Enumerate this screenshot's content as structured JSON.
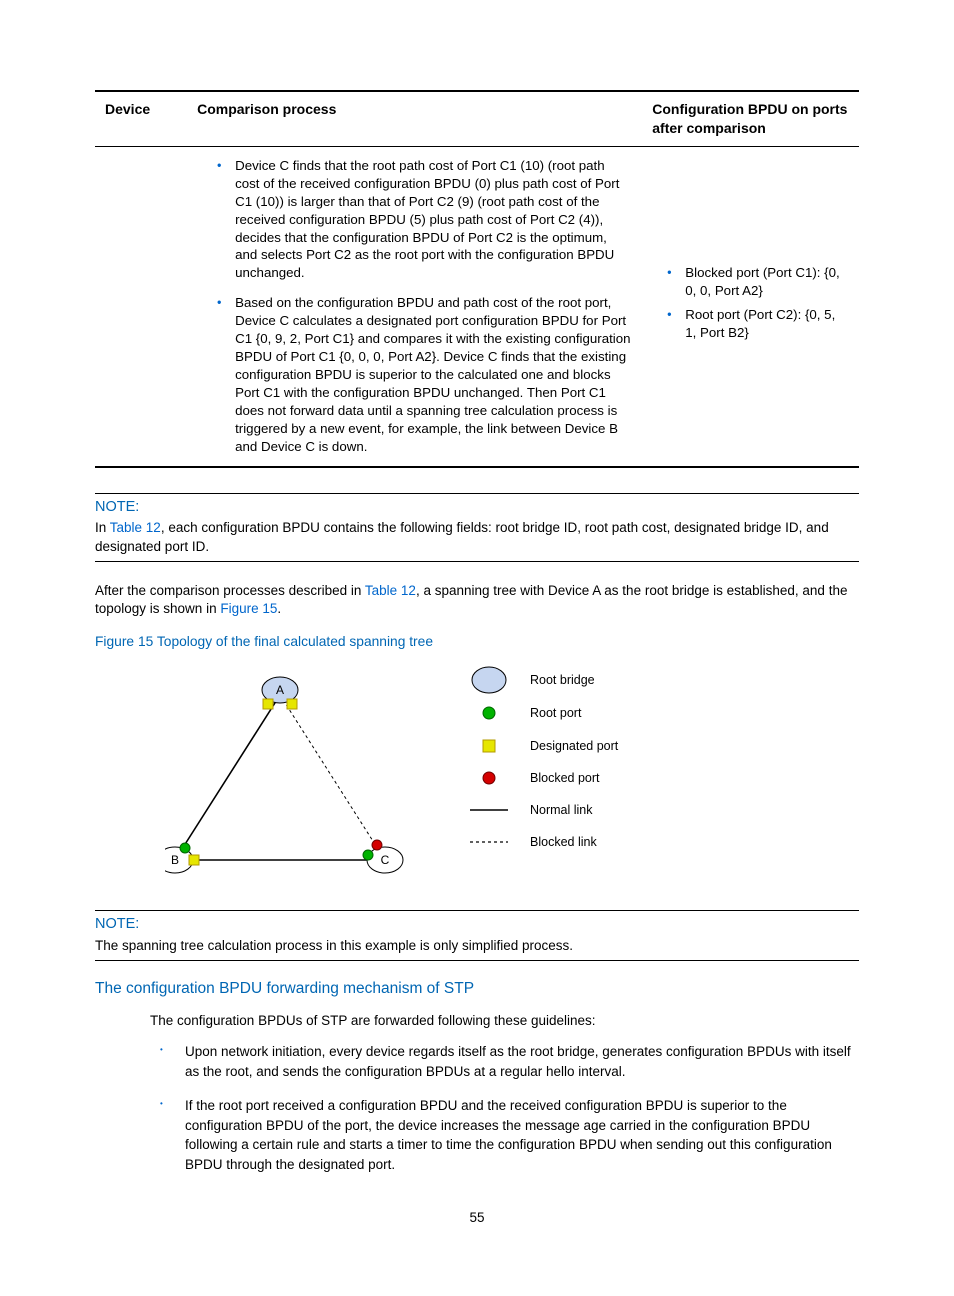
{
  "table": {
    "headers": {
      "device": "Device",
      "comparison": "Comparison process",
      "config": "Configuration BPDU on ports after comparison"
    },
    "row": {
      "comp_bullets": [
        "Device C finds that the root path cost of Port C1 (10) (root path cost of the received configuration BPDU (0) plus path cost of Port C1 (10)) is larger than that of Port C2 (9) (root path cost of the received configuration BPDU (5) plus path cost of Port C2 (4)), decides that the configuration BPDU of Port C2 is the optimum, and selects Port C2 as the root port with the configuration BPDU unchanged.",
        "Based on the configuration BPDU and path cost of the root port, Device C calculates a designated port configuration BPDU for Port C1 {0, 9, 2, Port C1} and compares it with the existing configuration BPDU of Port C1 {0, 0, 0, Port A2}. Device C finds that the existing configuration BPDU is superior to the calculated one and blocks Port C1 with the configuration BPDU unchanged. Then Port C1 does not forward data until a spanning tree calculation process is triggered by a new event, for example, the link between Device B and Device C is down."
      ],
      "config_bullets": [
        "Blocked port (Port C1): {0, 0, 0, Port A2}",
        "Root port (Port C2): {0, 5, 1, Port B2}"
      ]
    }
  },
  "note1": {
    "title": "NOTE:",
    "pre": "In ",
    "link": "Table 12",
    "post": ", each configuration BPDU contains the following fields: root bridge ID, root path cost, designated bridge ID, and designated port ID."
  },
  "para1": {
    "pre": "After the comparison processes described in ",
    "link1": "Table 12",
    "mid": ", a spanning tree with Device A as the root bridge is established, and the topology is shown in ",
    "link2": "Figure 15",
    "end": "."
  },
  "figure": {
    "caption": "Figure 15 Topology of the final calculated spanning tree",
    "nodes": {
      "a": "A",
      "b": "B",
      "c": "C"
    },
    "legend": {
      "root_bridge": "Root bridge",
      "root_port": "Root port",
      "designated_port": "Designated port",
      "blocked_port": "Blocked port",
      "normal_link": "Normal link",
      "blocked_link": "Blocked link"
    }
  },
  "note2": {
    "title": "NOTE:",
    "text": "The spanning tree calculation process in this example is only simplified process."
  },
  "section": {
    "heading": "The configuration BPDU forwarding mechanism of STP",
    "intro": "The configuration BPDUs of STP are forwarded following these guidelines:",
    "bullets": [
      "Upon network initiation, every device regards itself as the root bridge, generates configuration BPDUs with itself as the root, and sends the configuration BPDUs at a regular hello interval.",
      "If the root port received a configuration BPDU and the received configuration BPDU is superior to the configuration BPDU of the port, the device increases the message age carried in the configuration BPDU following a certain rule and starts a timer to time the configuration BPDU when sending out this configuration BPDU through the designated port."
    ]
  },
  "page_number": "55"
}
